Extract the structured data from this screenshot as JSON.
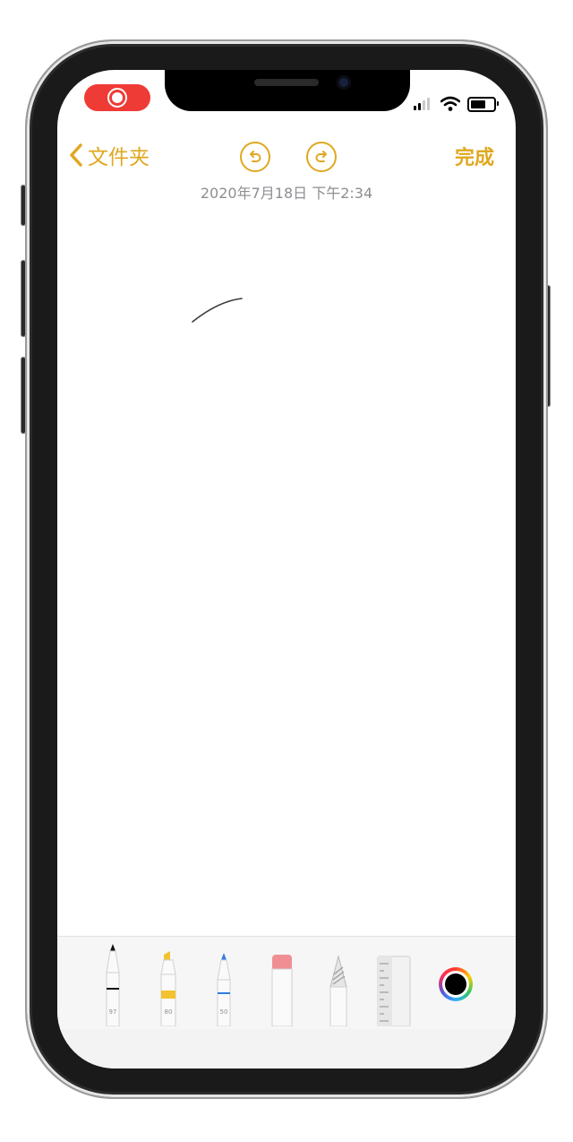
{
  "status_bar": {
    "recording_icon": "screen-recording-icon",
    "signal_icon": "cellular-signal-icon",
    "wifi_icon": "wifi-icon",
    "battery_icon": "battery-icon"
  },
  "nav": {
    "back_label": "文件夹",
    "undo_icon": "undo-icon",
    "redo_icon": "redo-icon",
    "done_label": "完成",
    "accent_color": "#e0a820"
  },
  "note": {
    "timestamp": "2020年7月18日 下午2:34"
  },
  "toolbar": {
    "tools": [
      {
        "name": "pen",
        "label": "97"
      },
      {
        "name": "marker",
        "label": "80"
      },
      {
        "name": "pencil",
        "label": "50"
      },
      {
        "name": "eraser",
        "label": ""
      },
      {
        "name": "lasso",
        "label": ""
      },
      {
        "name": "ruler",
        "label": ""
      }
    ],
    "color_picker": {
      "selected_color": "#000000"
    }
  }
}
